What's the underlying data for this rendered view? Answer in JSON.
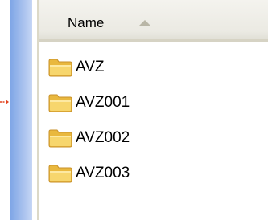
{
  "column_header": {
    "name_label": "Name"
  },
  "folders": [
    {
      "label": "AVZ",
      "icon": "folder-icon"
    },
    {
      "label": "AVZ001",
      "icon": "folder-icon"
    },
    {
      "label": "AVZ002",
      "icon": "folder-icon"
    },
    {
      "label": "AVZ003",
      "icon": "folder-icon"
    }
  ],
  "colors": {
    "sidebar_blue": "#7fa6e6",
    "header_bg": "#ebeae3",
    "folder_yellow": "#f6d36b",
    "pointer_red": "#e2431f"
  }
}
